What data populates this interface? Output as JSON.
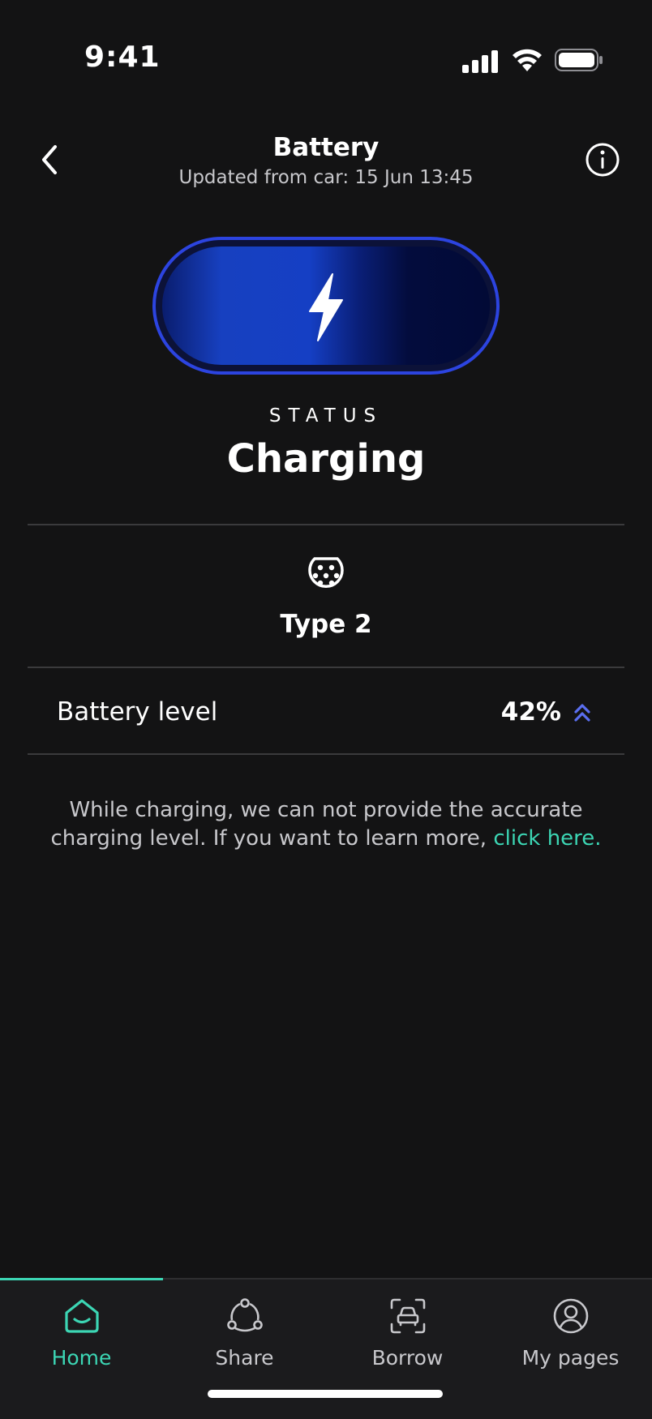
{
  "status_bar": {
    "time": "9:41",
    "icons": [
      "signal-icon",
      "wifi-icon",
      "battery-icon"
    ]
  },
  "header": {
    "title": "Battery",
    "subtitle": "Updated from car: 15 Jun 13:45",
    "back_icon": "chevron-left-icon",
    "info_icon": "info-icon"
  },
  "battery_visual": {
    "icon": "lightning-bolt-icon",
    "accent_color": "#2c44e0"
  },
  "status": {
    "label": "STATUS",
    "value": "Charging"
  },
  "connector": {
    "icon": "type2-connector-icon",
    "label": "Type 2"
  },
  "battery_level": {
    "label": "Battery level",
    "value": "42%",
    "trend_icon": "double-chevron-up-icon",
    "trend_color": "#5a6ef0"
  },
  "info": {
    "text": "While charging, we can not provide the accurate charging level. If you want to learn more,",
    "link": "click here."
  },
  "tabs": [
    {
      "label": "Home",
      "icon": "home-icon",
      "active": true
    },
    {
      "label": "Share",
      "icon": "share-icon",
      "active": false
    },
    {
      "label": "Borrow",
      "icon": "car-scan-icon",
      "active": false
    },
    {
      "label": "My pages",
      "icon": "user-icon",
      "active": false
    }
  ],
  "colors": {
    "background": "#131314",
    "accent": "#3cd6b4"
  }
}
